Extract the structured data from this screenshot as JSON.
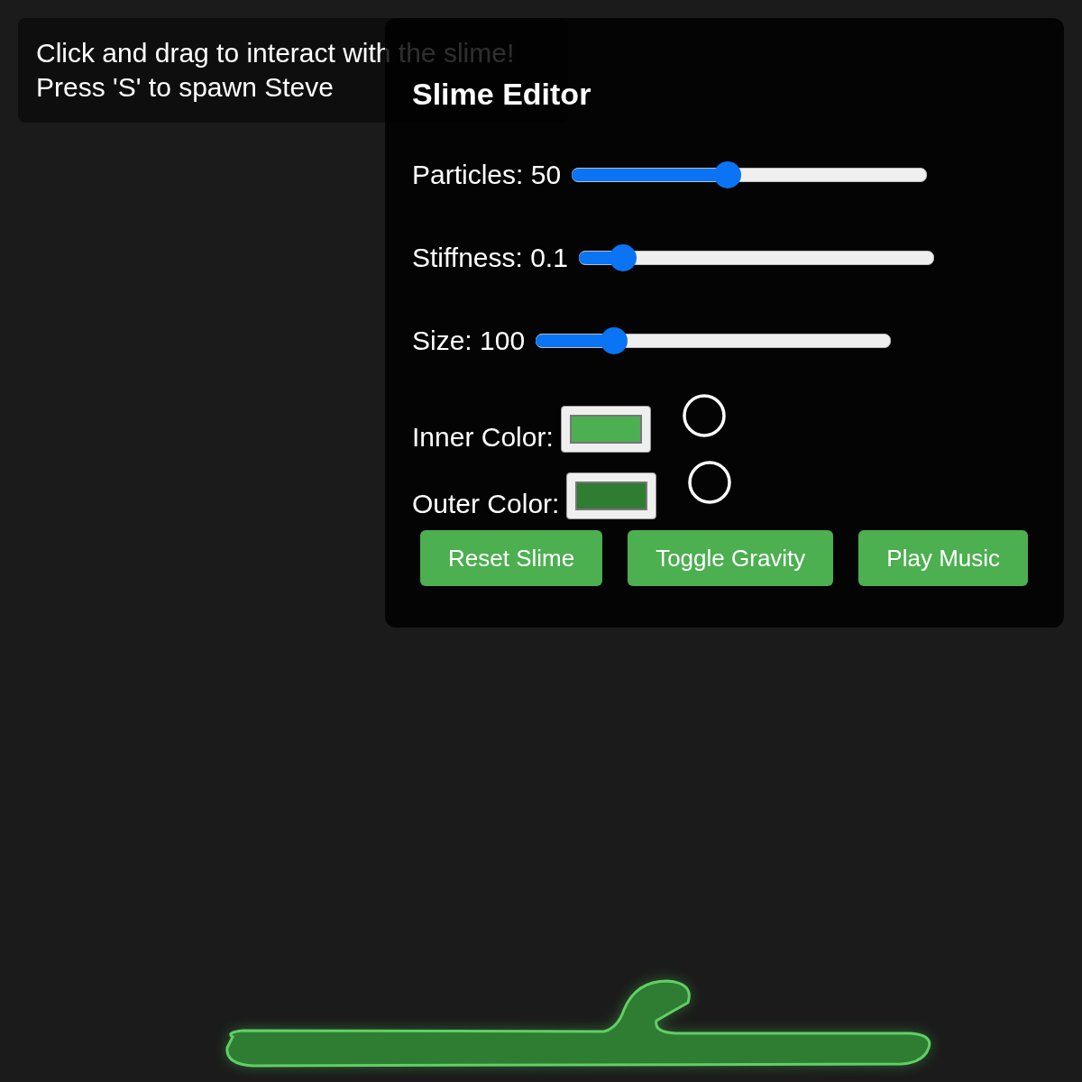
{
  "info": {
    "lines": [
      "Click and drag to interact with the slime!",
      "Press 'S' to spawn Steve"
    ]
  },
  "editor": {
    "title": "Slime Editor",
    "sliders": [
      {
        "label": "Particles: 50",
        "level": 0.44
      },
      {
        "label": "Stiffness: 0.1",
        "level": 0.125
      },
      {
        "label": "Size: 100",
        "level": 0.22
      }
    ],
    "colors": [
      {
        "label": "Inner Color:",
        "color": "#4caf50"
      },
      {
        "label": "Outer Color:",
        "color": "#2e7d32"
      }
    ],
    "buttons": [
      "Reset Slime",
      "Toggle Gravity",
      "Play Music"
    ]
  }
}
